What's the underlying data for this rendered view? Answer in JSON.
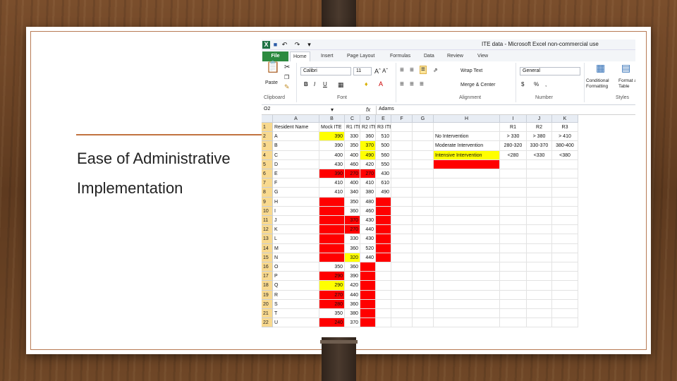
{
  "slide": {
    "lines": [
      "Ease of Administrative",
      "Implementation"
    ]
  },
  "colors": {
    "accent": "#c1733f",
    "excel_green": "#2c8a3f",
    "red": "#ff0000",
    "yellow": "#ffff00"
  },
  "excel": {
    "title": "ITE data - Microsoft Excel non-commercial use",
    "tabs": [
      "File",
      "Home",
      "Insert",
      "Page Layout",
      "Formulas",
      "Data",
      "Review",
      "View"
    ],
    "font_name": "Calibri",
    "font_size": "11",
    "number_format": "General",
    "wrap_text": "Wrap Text",
    "merge_center": "Merge & Center",
    "paste": "Paste",
    "conditional_formatting": "Conditional Formatting",
    "format_as_table": "Format as Table",
    "groups": [
      "Clipboard",
      "Font",
      "Alignment",
      "Number",
      "Styles"
    ],
    "name_box": "O2",
    "formula": "Adams",
    "fx": "fx",
    "columns": [
      "A",
      "B",
      "C",
      "D",
      "E",
      "F",
      "G",
      "H",
      "I",
      "J",
      "K"
    ],
    "rows": [
      [
        "1",
        "Resident Name",
        "Mock ITE",
        "R1 ITE",
        "R2 ITE",
        "R3 ITE",
        "",
        "",
        "",
        "R1",
        "R2",
        "R3"
      ],
      [
        "2",
        "A",
        "390",
        "330",
        "360",
        "510",
        "",
        "",
        "No Intervention",
        "> 330",
        "> 380",
        "> 410"
      ],
      [
        "3",
        "B",
        "390",
        "350",
        "370",
        "500",
        "",
        "",
        "Moderate Intervention",
        "280-320",
        "330-370",
        "380-400"
      ],
      [
        "4",
        "C",
        "400",
        "400",
        "490",
        "560",
        "",
        "",
        "Intensive Intervention",
        "<280",
        "<330",
        "<380"
      ],
      [
        "5",
        "D",
        "430",
        "460",
        "420",
        "550",
        "",
        "",
        "",
        "",
        "",
        ""
      ],
      [
        "6",
        "E",
        "390",
        "270",
        "270",
        "430",
        "",
        "",
        "",
        "",
        "",
        ""
      ],
      [
        "7",
        "F",
        "410",
        "400",
        "410",
        "610",
        "",
        "",
        "",
        "",
        "",
        ""
      ],
      [
        "8",
        "G",
        "410",
        "340",
        "380",
        "490",
        "",
        "",
        "",
        "",
        "",
        ""
      ],
      [
        "9",
        "H",
        "",
        "350",
        "480",
        "",
        "",
        "",
        "",
        "",
        "",
        ""
      ],
      [
        "10",
        "I",
        "",
        "360",
        "460",
        "",
        "",
        "",
        "",
        "",
        "",
        ""
      ],
      [
        "11",
        "J",
        "",
        "370",
        "430",
        "",
        "",
        "",
        "",
        "",
        "",
        ""
      ],
      [
        "12",
        "K",
        "",
        "270",
        "440",
        "",
        "",
        "",
        "",
        "",
        "",
        ""
      ],
      [
        "13",
        "L",
        "",
        "330",
        "430",
        "",
        "",
        "",
        "",
        "",
        "",
        ""
      ],
      [
        "14",
        "M",
        "",
        "360",
        "520",
        "",
        "",
        "",
        "",
        "",
        "",
        ""
      ],
      [
        "15",
        "N",
        "",
        "320",
        "440",
        "",
        "",
        "",
        "",
        "",
        "",
        ""
      ],
      [
        "16",
        "O",
        "350",
        "360",
        "",
        "",
        "",
        "",
        "",
        "",
        "",
        ""
      ],
      [
        "17",
        "P",
        "290",
        "390",
        "",
        "",
        "",
        "",
        "",
        "",
        "",
        ""
      ],
      [
        "18",
        "Q",
        "290",
        "420",
        "",
        "",
        "",
        "",
        "",
        "",
        "",
        ""
      ],
      [
        "19",
        "R",
        "270",
        "440",
        "",
        "",
        "",
        "",
        "",
        "",
        "",
        ""
      ],
      [
        "20",
        "S",
        "280",
        "360",
        "",
        "",
        "",
        "",
        "",
        "",
        "",
        ""
      ],
      [
        "21",
        "T",
        "350",
        "380",
        "",
        "",
        "",
        "",
        "",
        "",
        "",
        ""
      ],
      [
        "22",
        "U",
        "240",
        "370",
        "",
        "",
        "",
        "",
        "",
        "",
        "",
        ""
      ]
    ],
    "fills": {
      "1": {
        "1": "yel"
      },
      "2": {
        "3": "yel",
        "7": "none"
      },
      "3": {
        "3": "yel",
        "7": "yel"
      },
      "4": {
        "7": "red"
      },
      "5": {
        "1": "red",
        "2": "red",
        "3": "red"
      },
      "8": {
        "1": "red",
        "4": "red"
      },
      "9": {
        "1": "red",
        "4": "red"
      },
      "10": {
        "1": "red",
        "2": "red",
        "4": "red"
      },
      "11": {
        "1": "red",
        "2": "red",
        "4": "red"
      },
      "12": {
        "1": "red",
        "4": "red"
      },
      "13": {
        "1": "red",
        "4": "red"
      },
      "14": {
        "1": "red",
        "2": "yel",
        "4": "red"
      },
      "15": {
        "3": "red"
      },
      "16": {
        "1": "red",
        "3": "red"
      },
      "17": {
        "1": "yel",
        "3": "red"
      },
      "18": {
        "1": "red",
        "3": "red"
      },
      "19": {
        "1": "red",
        "3": "red"
      },
      "20": {
        "3": "red"
      },
      "21": {
        "1": "red",
        "3": "red"
      }
    }
  }
}
